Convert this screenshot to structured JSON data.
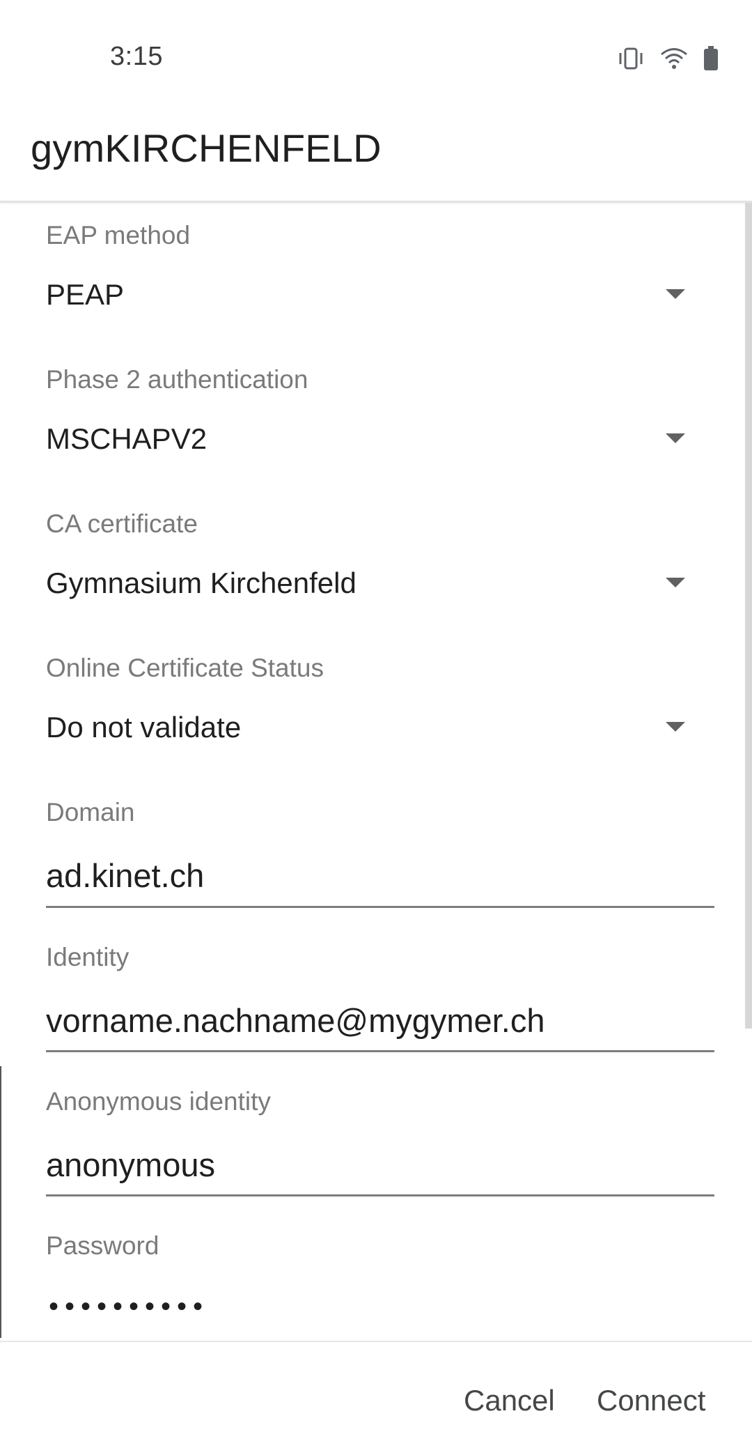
{
  "status_bar": {
    "time": "3:15",
    "icons": [
      "vibrate-icon",
      "wifi-icon",
      "battery-icon"
    ]
  },
  "dialog": {
    "title": "gymKIRCHENFELD"
  },
  "fields": {
    "eap_method": {
      "label": "EAP method",
      "value": "PEAP"
    },
    "phase2_auth": {
      "label": "Phase 2 authentication",
      "value": "MSCHAPV2"
    },
    "ca_certificate": {
      "label": "CA certificate",
      "value": "Gymnasium Kirchenfeld"
    },
    "ocsp": {
      "label": "Online Certificate Status",
      "value": "Do not validate"
    },
    "domain": {
      "label": "Domain",
      "value": "ad.kinet.ch"
    },
    "identity": {
      "label": "Identity",
      "value": "vorname.nachname@mygymer.ch"
    },
    "anonymous_identity": {
      "label": "Anonymous identity",
      "value": "anonymous"
    },
    "password": {
      "label": "Password",
      "value": "••••••••••"
    }
  },
  "actions": {
    "cancel_label": "Cancel",
    "connect_label": "Connect"
  },
  "colors": {
    "label_text": "#7a7a7a",
    "value_text": "#1f1f1f",
    "button_text": "#444746",
    "underline": "#7d7d7d"
  }
}
